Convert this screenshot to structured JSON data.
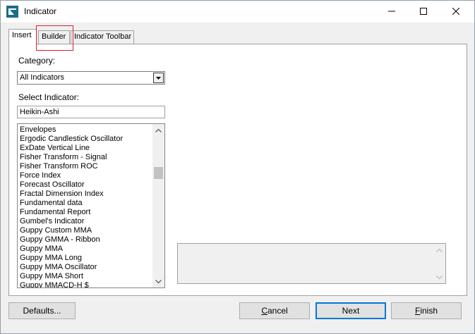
{
  "window": {
    "title": "Indicator"
  },
  "tabs": [
    {
      "label": "Insert"
    },
    {
      "label": "Builder"
    },
    {
      "label": "Indicator Toolbar"
    }
  ],
  "category": {
    "label": "Category:",
    "selected": "All Indicators"
  },
  "select_indicator": {
    "label": "Select Indicator:",
    "value": "Heikin-Ashi"
  },
  "indicator_list": [
    "Envelopes",
    "Ergodic Candlestick Oscillator",
    "ExDate Vertical Line",
    "Fisher Transform - Signal",
    "Fisher Transform ROC",
    "Force Index",
    "Forecast Oscillator",
    "Fractal Dimension Index",
    "Fundamental data",
    "Fundamental Report",
    "Gumbel's Indicator",
    "Guppy Custom MMA",
    "Guppy GMMA - Ribbon",
    "Guppy MMA",
    "Guppy MMA Long",
    "Guppy MMA Oscillator",
    "Guppy MMA Short",
    "Guppy MMACD-H $"
  ],
  "buttons": {
    "defaults": "Defaults...",
    "cancel_pre": "",
    "cancel_underline": "C",
    "cancel_post": "ancel",
    "next": "Next",
    "finish_pre": "",
    "finish_underline": "F",
    "finish_post": "inish"
  },
  "colors": {
    "highlight": "#e0202a",
    "focus": "#0078d7"
  }
}
